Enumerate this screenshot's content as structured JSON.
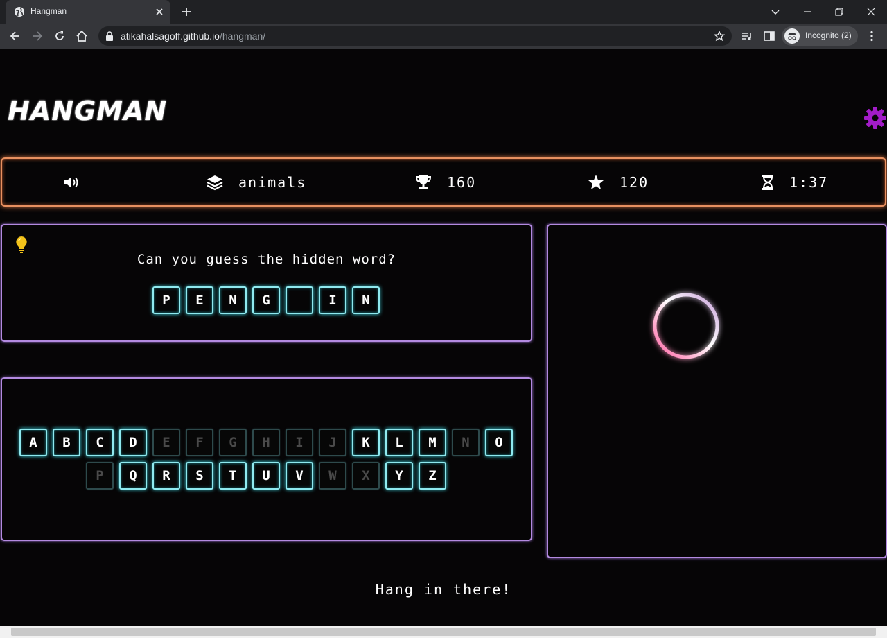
{
  "browser": {
    "tab_title": "Hangman",
    "url_host": "atikahalsagoff.github.io",
    "url_path": "/hangman/",
    "profile_label": "Incognito (2)"
  },
  "header": {
    "logo": "HANGMAN",
    "settings_icon": "gear-icon",
    "accent_color": "#a21cc8"
  },
  "stats": {
    "sound_icon": "volume-icon",
    "category_icon": "layers-icon",
    "category": "animals",
    "trophy_icon": "trophy-icon",
    "high_score": "160",
    "star_icon": "star-icon",
    "score": "120",
    "timer_icon": "hourglass-icon",
    "time": "1:37"
  },
  "puzzle": {
    "hint_icon": "lightbulb-icon",
    "prompt": "Can you guess the hidden word?",
    "slots": [
      "P",
      "E",
      "N",
      "G",
      "",
      "I",
      "N"
    ]
  },
  "keyboard": {
    "rows": [
      [
        "A",
        "B",
        "C",
        "D",
        "E",
        "F",
        "G",
        "H",
        "I",
        "J",
        "K",
        "L",
        "M",
        "N",
        "O"
      ],
      [
        "P",
        "Q",
        "R",
        "S",
        "T",
        "U",
        "V",
        "W",
        "X",
        "Y",
        "Z"
      ]
    ],
    "used": [
      "E",
      "F",
      "G",
      "H",
      "I",
      "J",
      "N",
      "P",
      "W",
      "X"
    ]
  },
  "gallows": {
    "stroke_gradient": [
      "#ff5fa2",
      "#ffffff",
      "#c79ed9"
    ]
  },
  "status": {
    "message": "Hang in there!"
  }
}
